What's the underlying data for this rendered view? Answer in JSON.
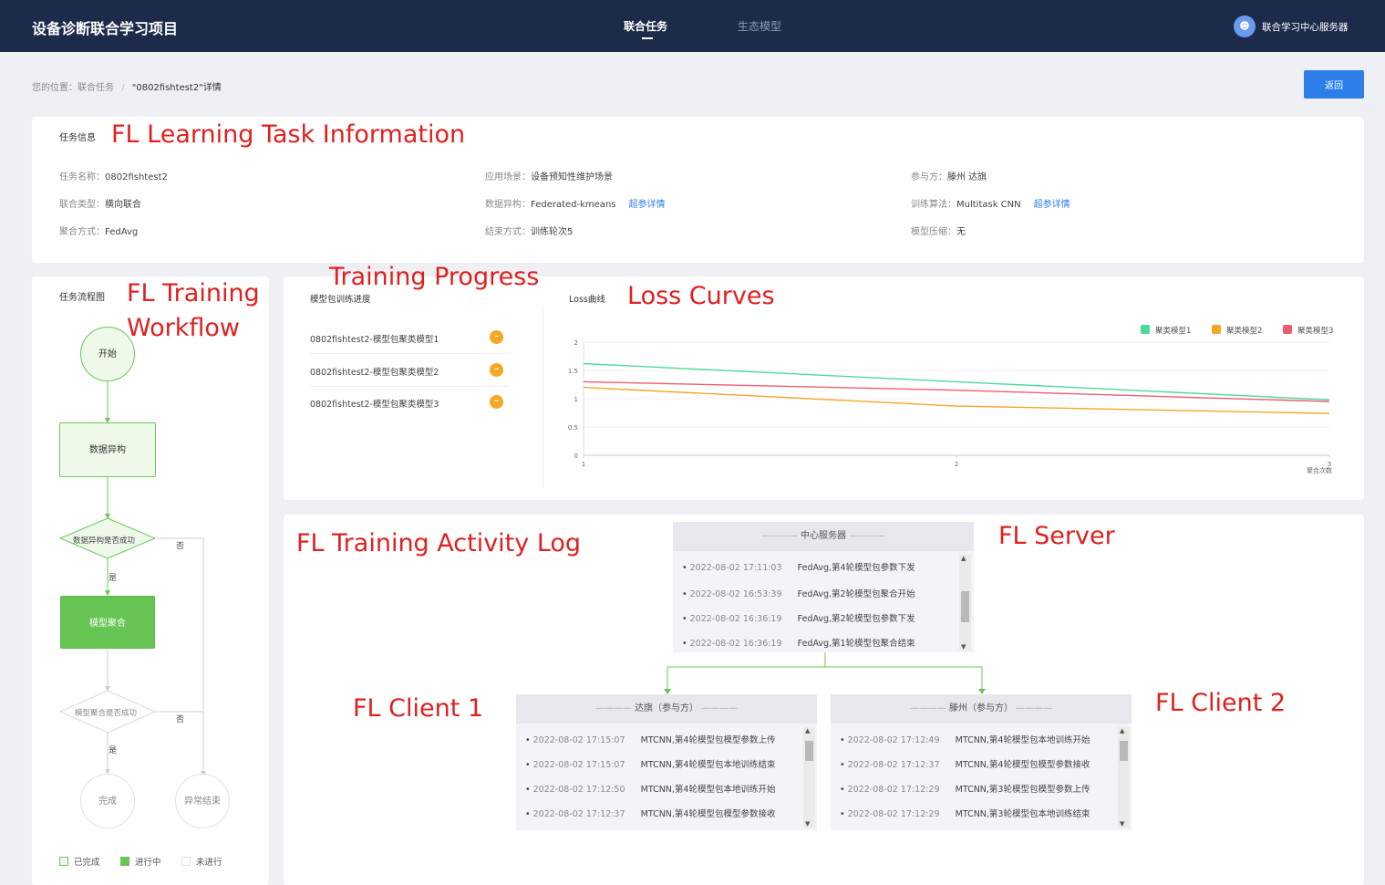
{
  "header": {
    "brand": "设备诊断联合学习项目",
    "nav": [
      "联合任务",
      "生态模型"
    ],
    "user": "联合学习中心服务器",
    "avatar_icon": "user-icon"
  },
  "breadcrumb": {
    "prefix": "您的位置：联合任务",
    "sep": "/",
    "current": "\"0802fishtest2\"详情"
  },
  "back_button": "返回",
  "annotations": {
    "task_info": "FL Learning Task Information",
    "workflow_1": "FL Training",
    "workflow_2": "Workflow",
    "progress": "Training Progress",
    "loss": "Loss Curves",
    "log": "FL Training Activity Log",
    "server": "FL Server",
    "client1": "FL Client 1",
    "client2": "FL Client 2"
  },
  "task_info": {
    "title": "任务信息",
    "name_label": "任务名称：",
    "name": "0802fishtest2",
    "scene_label": "应用场景：",
    "scene": "设备预知性维护场景",
    "parties_label": "参与方：",
    "parties": "滕州  达旗",
    "fed_type_label": "联合类型：",
    "fed_type": "横向联合",
    "hetero_label": "数据异构：",
    "hetero": "Federated-kmeans",
    "hetero_link": "超参详情",
    "algo_label": "训练算法：",
    "algo": "Multitask CNN",
    "algo_link": "超参详情",
    "agg_label": "聚合方式：",
    "agg": "FedAvg",
    "end_label": "结束方式：",
    "end": "训练轮次5",
    "compress_label": "模型压缩：",
    "compress": "无"
  },
  "workflow": {
    "title": "任务流程图",
    "start": "开始",
    "hetero": "数据异构",
    "hetero_check": "数据异构是否成功",
    "aggregate": "模型聚合",
    "agg_check": "模型聚合是否成功",
    "yes": "是",
    "no": "否",
    "done": "完成",
    "abnormal": "异常结束",
    "legend": [
      "已完成",
      "进行中",
      "未进行"
    ]
  },
  "progress": {
    "title": "模型包训练进度",
    "items": [
      "0802fishtest2-模型包聚类模型1",
      "0802fishtest2-模型包聚类模型2",
      "0802fishtest2-模型包聚类模型3"
    ],
    "status_icon": "pending-icon",
    "status_glyph": "–"
  },
  "chart_data": {
    "type": "line",
    "title": "Loss曲线",
    "xlabel": "聚合次数",
    "ylabel": "",
    "x": [
      1,
      2,
      3
    ],
    "xlim": [
      1,
      3
    ],
    "ylim": [
      0,
      2
    ],
    "yticks": [
      0,
      0.5,
      1,
      1.5,
      2
    ],
    "xticks": [
      1,
      2,
      3
    ],
    "legend_position": "top-right",
    "series": [
      {
        "name": "聚类模型1",
        "color": "#4cd99a",
        "values": [
          1.62,
          1.3,
          0.98
        ]
      },
      {
        "name": "聚类模型2",
        "color": "#f5a623",
        "values": [
          1.2,
          0.87,
          0.74
        ]
      },
      {
        "name": "聚类模型3",
        "color": "#ee5d6f",
        "values": [
          1.3,
          1.15,
          0.95
        ]
      }
    ]
  },
  "logs": {
    "server": {
      "title": "中心服务器",
      "lines": [
        {
          "ts": "2022-08-02 17:11:03",
          "msg": "FedAvg,第4轮模型包参数下发"
        },
        {
          "ts": "2022-08-02 16:53:39",
          "msg": "FedAvg,第2轮模型包聚合开始"
        },
        {
          "ts": "2022-08-02 16:36:19",
          "msg": "FedAvg,第2轮模型包参数下发"
        },
        {
          "ts": "2022-08-02 16:36:19",
          "msg": "FedAvg,第1轮模型包聚合结束"
        }
      ]
    },
    "client1": {
      "title": "达旗（参与方）",
      "lines": [
        {
          "ts": "2022-08-02 17:15:07",
          "msg": "MTCNN,第4轮模型包模型参数上传"
        },
        {
          "ts": "2022-08-02 17:15:07",
          "msg": "MTCNN,第4轮模型包本地训练结束"
        },
        {
          "ts": "2022-08-02 17:12:50",
          "msg": "MTCNN,第4轮模型包本地训练开始"
        },
        {
          "ts": "2022-08-02 17:12:37",
          "msg": "MTCNN,第4轮模型包模型参数接收"
        }
      ]
    },
    "client2": {
      "title": "滕州（参与方）",
      "lines": [
        {
          "ts": "2022-08-02 17:12:49",
          "msg": "MTCNN,第4轮模型包本地训练开始"
        },
        {
          "ts": "2022-08-02 17:12:37",
          "msg": "MTCNN,第4轮模型包模型参数接收"
        },
        {
          "ts": "2022-08-02 17:12:29",
          "msg": "MTCNN,第3轮模型包模型参数上传"
        },
        {
          "ts": "2022-08-02 17:12:29",
          "msg": "MTCNN,第3轮模型包本地训练结束"
        }
      ]
    }
  }
}
